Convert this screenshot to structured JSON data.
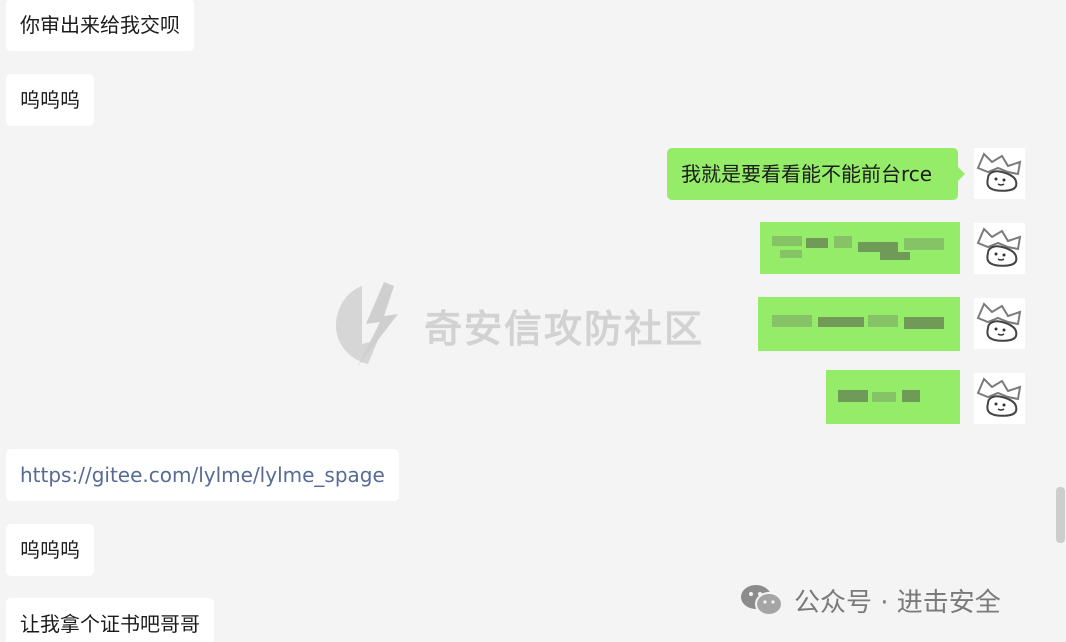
{
  "messages": {
    "m1": "你审出来给我交呗",
    "m2": "呜呜呜",
    "m3": "我就是要看看能不能前台rce",
    "m4": "https://gitee.com/lylme/lylme_spage",
    "m5": "呜呜呜",
    "m6": "让我拿个证书吧哥哥"
  },
  "watermark": {
    "text": "奇安信攻防社区"
  },
  "footer": {
    "account": "公众号 · 进击安全"
  },
  "colors": {
    "background": "#f4f4f4",
    "incoming_bubble": "#ffffff",
    "outgoing_bubble": "#95ec69",
    "link": "#576b95"
  },
  "icons": {
    "avatar": "cartoon-cat-avatar-icon",
    "watermark_logo": "lightning-shield-icon",
    "footer_logo": "wechat-icon"
  }
}
